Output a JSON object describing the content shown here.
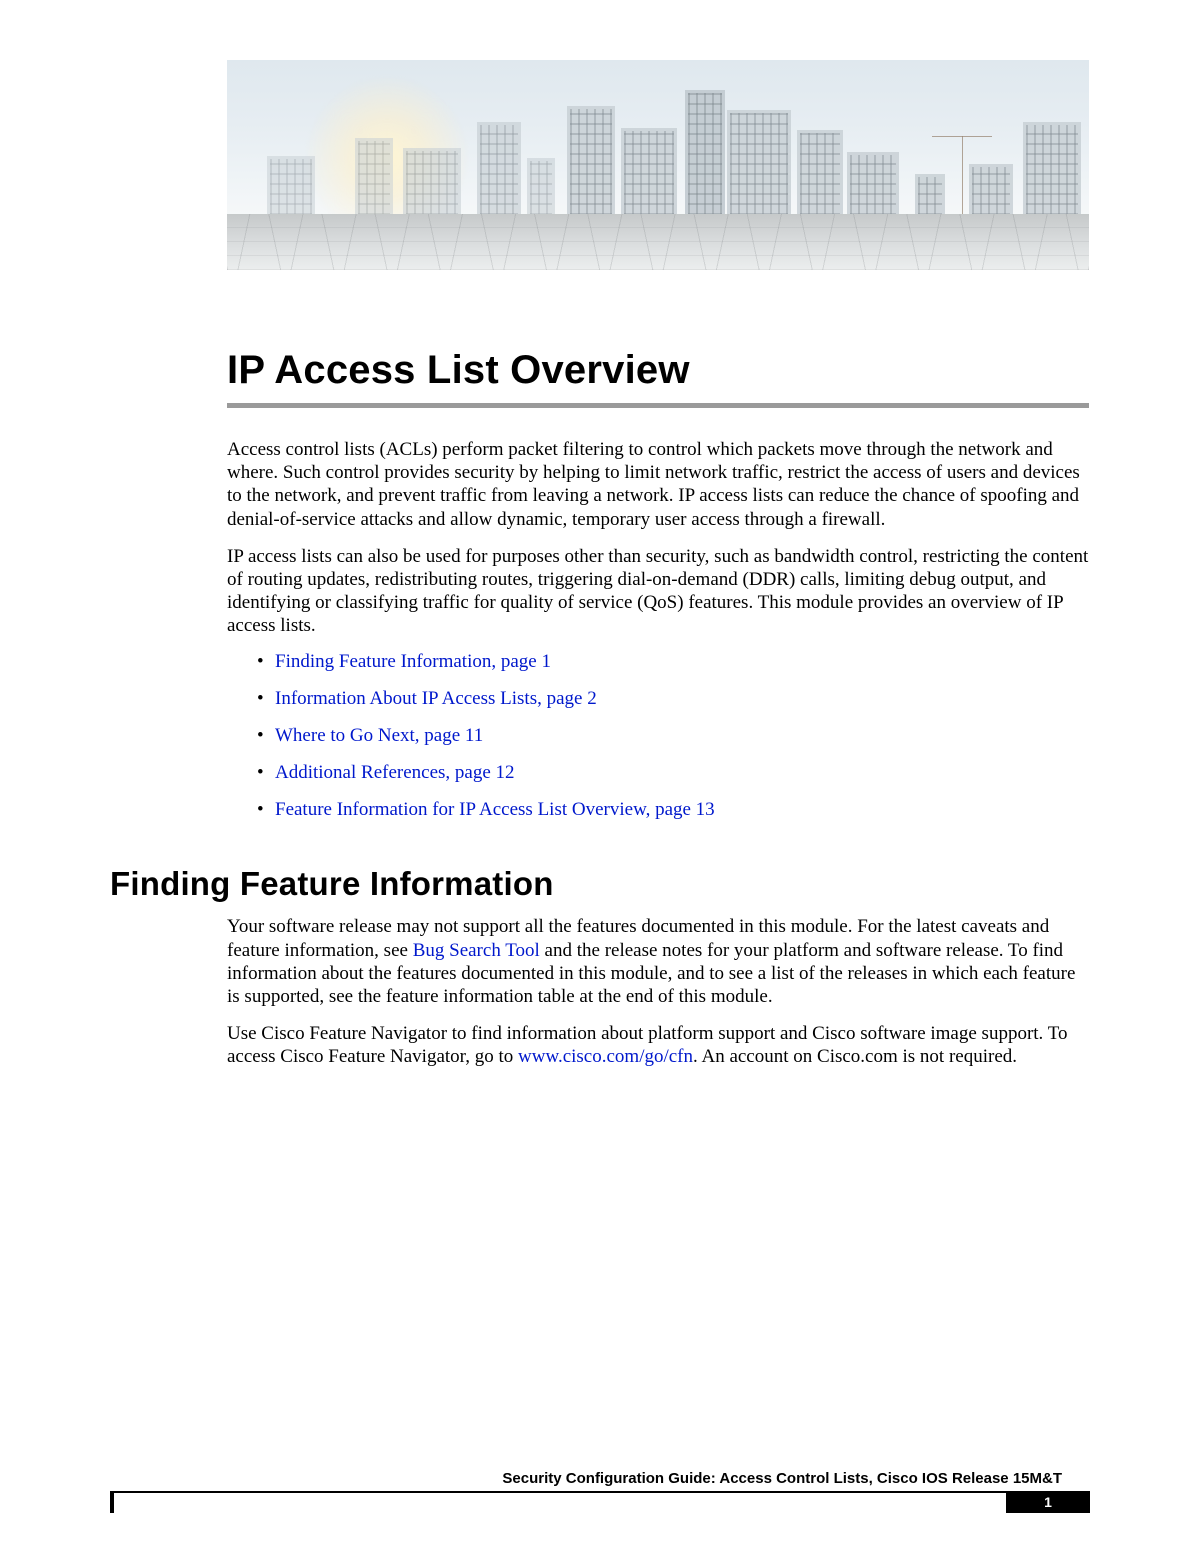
{
  "title": "IP Access List Overview",
  "intro_paragraphs": [
    "Access control lists (ACLs) perform packet filtering to control which packets move through the network and where. Such control provides security by helping to limit network traffic, restrict the access of users and devices to the network, and prevent traffic from leaving a network. IP access lists can reduce the chance of spoofing and denial-of-service attacks and allow dynamic, temporary user access through a firewall.",
    "IP access lists can also be used for purposes other than security, such as bandwidth control, restricting the content of routing updates, redistributing routes, triggering dial-on-demand (DDR) calls, limiting debug output, and identifying or classifying traffic for quality of service (QoS) features. This module provides an overview of IP access lists."
  ],
  "toc": [
    "Finding Feature Information,  page  1",
    "Information About IP Access Lists,  page  2",
    "Where to Go Next,  page  11",
    "Additional References,  page  12",
    "Feature Information for IP Access List Overview,  page  13"
  ],
  "section": {
    "heading": "Finding Feature Information",
    "p1_a": "Your software release may not support all the features documented in this module. For the latest caveats and feature information, see ",
    "p1_link1": "Bug Search Tool",
    "p1_b": " and the release notes for your platform and software release. To find information about the features documented in this module, and to see a list of the releases in which each feature is supported, see the feature information table at the end of this module.",
    "p2_a": "Use Cisco Feature Navigator to find information about platform support and Cisco software image support. To access Cisco Feature Navigator, go to ",
    "p2_link1": "www.cisco.com/go/cfn",
    "p2_b": ". An account on Cisco.com is not required."
  },
  "footer": {
    "doc_title": "Security Configuration Guide: Access Control Lists, Cisco IOS Release 15M&T",
    "page_number": "1"
  }
}
